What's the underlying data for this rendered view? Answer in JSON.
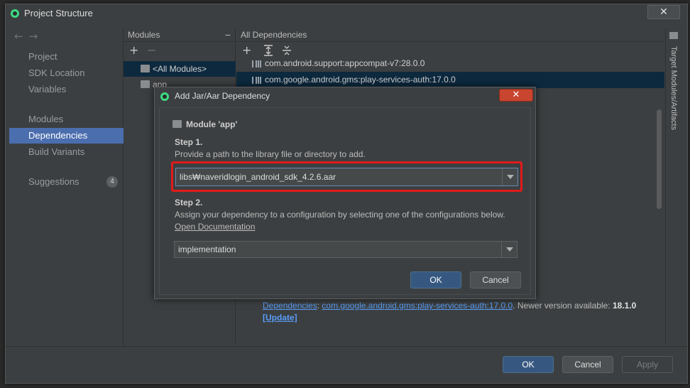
{
  "window": {
    "title": "Project Structure",
    "close_glyph": "✕"
  },
  "sidebar": {
    "items": [
      {
        "label": "Project"
      },
      {
        "label": "SDK Location"
      },
      {
        "label": "Variables"
      },
      {
        "label": "Modules"
      },
      {
        "label": "Dependencies",
        "selected": true
      },
      {
        "label": "Build Variants"
      },
      {
        "label": "Suggestions",
        "badge": "4"
      }
    ]
  },
  "modules_pane": {
    "header": "Modules",
    "add_glyph": "+",
    "remove_glyph": "−",
    "rows": [
      {
        "label": "<All Modules>",
        "selected": true
      },
      {
        "label": "app"
      }
    ]
  },
  "deps_pane": {
    "header": "All Dependencies",
    "rows": [
      {
        "label": "com.android.support:appcompat-v7:28.0.0"
      },
      {
        "label": "com.google.android.gms:play-services-auth:17.0.0",
        "selected": true
      }
    ],
    "info_link_1": "Dependencies",
    "info_dep": "com.google.android.gms:play-services-auth:17.0.0",
    "info_text": ". Newer version available: ",
    "info_version": "18.1.0",
    "info_update": "[Update]"
  },
  "right_strip": {
    "label": "Target Modules/Artifacts"
  },
  "bottom": {
    "ok": "OK",
    "cancel": "Cancel",
    "apply": "Apply"
  },
  "dialog": {
    "title": "Add Jar/Aar Dependency",
    "close_glyph": "✕",
    "module_label": "Module 'app'",
    "step1_title": "Step 1.",
    "step1_desc": "Provide a path to the library file or directory to add.",
    "path_value": "libs₩naveridlogin_android_sdk_4.2.6.aar",
    "step2_title": "Step 2.",
    "step2_desc": "Assign your dependency to a configuration by selecting one of the configurations below.",
    "open_docs": "Open Documentation",
    "config_value": "implementation",
    "ok": "OK",
    "cancel": "Cancel"
  },
  "colors": {
    "accent": "#4b6eaf",
    "selected_row": "#0d293e",
    "highlight_box": "#e01b1b",
    "link": "#589df6"
  }
}
